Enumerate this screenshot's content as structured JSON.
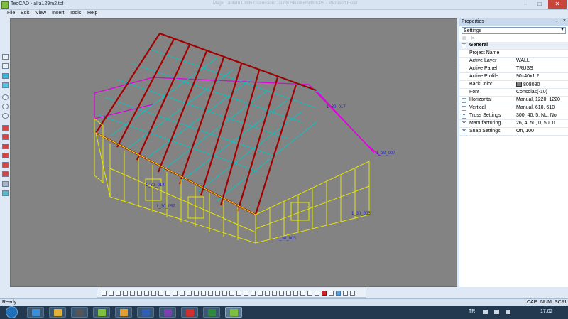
{
  "window": {
    "title": "TeoCAD - alfa129m2.tcf",
    "ghost_title": "Magic Lantern Limits Discussion: Jaunty Skunk Rhythm PS - Microsoft Excel"
  },
  "menu": [
    "File",
    "Edit",
    "View",
    "Insert",
    "Tools",
    "Help"
  ],
  "left_toolbar_icons": [
    "box-icon",
    "box-icon",
    "layer-icon",
    "cube-icon",
    "zoom-in-icon",
    "zoom-out-icon",
    "globe-icon",
    "red-box-icon",
    "red-box-icon",
    "red-box-icon",
    "red-box-icon",
    "red-box-icon",
    "red-box-icon",
    "stack-icon",
    "eye-icon"
  ],
  "properties": {
    "title": "Properties",
    "pin": "↓",
    "close": "×",
    "selector": "Settings",
    "sections": [
      {
        "name": "General",
        "expanded": true,
        "rows": [
          {
            "label": "Project Name",
            "value": ""
          },
          {
            "label": "Active Layer",
            "value": "WALL"
          },
          {
            "label": "Active Panel",
            "value": "TRUSS"
          },
          {
            "label": "Active Profile",
            "value": "90x40x1.2"
          },
          {
            "label": "BackColor",
            "value": "808080",
            "swatch": "#808080"
          },
          {
            "label": "Font",
            "value": "Consolas(-10)"
          },
          {
            "label": "Horizontal",
            "value": "Manual, 1220, 1220",
            "expandable": true
          },
          {
            "label": "Vertical",
            "value": "Manual, 610, 610",
            "expandable": true
          },
          {
            "label": "Truss Settings",
            "value": "300, 40, 5, No, No",
            "expandable": true
          },
          {
            "label": "Manufacturing",
            "value": "26, 4, 50, 0, 50, 0",
            "expandable": true
          },
          {
            "label": "Snap Settings",
            "value": "On, 100",
            "expandable": true
          }
        ]
      }
    ]
  },
  "model_labels": {
    "wall_1": "1_30_014",
    "wall_2": "1_30_005",
    "wall_3": "1_30_003",
    "wall_4": "1_30_007",
    "wall_5": "1_30_057",
    "wall_6": "1_30_017"
  },
  "status": {
    "text": "Ready",
    "cap": "CAP",
    "num": "NUM",
    "scrl": "SCRL"
  },
  "taskbar": {
    "lang": "TR",
    "time": "17:02",
    "apps": [
      "ie",
      "files",
      "winamp",
      "teocad",
      "chrome",
      "word",
      "yahoo",
      "yandex",
      "excel",
      "teocad2"
    ]
  },
  "colors": {
    "canvas_bg": "#808080",
    "wall": "#e6e600",
    "roof_truss": "#b30000",
    "purlin": "#00c8c8",
    "magenta": "#e000e0"
  }
}
